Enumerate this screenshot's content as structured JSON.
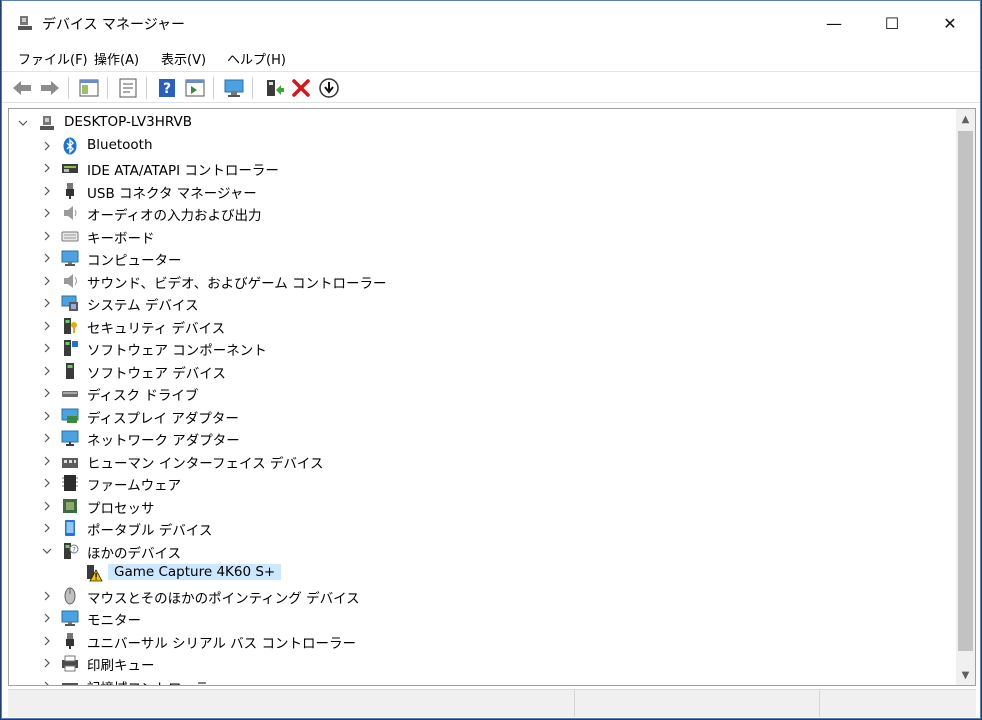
{
  "window": {
    "title": "デバイス マネージャー",
    "controls": {
      "minimize": "—",
      "maximize": "☐",
      "close": "✕"
    }
  },
  "menu": [
    {
      "label": "ファイル(F)"
    },
    {
      "label": "操作(A)"
    },
    {
      "label": "表示(V)"
    },
    {
      "label": "ヘルプ(H)"
    }
  ],
  "toolbar": [
    {
      "name": "back-icon",
      "enabled": false
    },
    {
      "name": "forward-icon",
      "enabled": false
    },
    {
      "name": "show-hide-console-tree-icon",
      "enabled": true
    },
    {
      "name": "properties-icon",
      "enabled": true
    },
    {
      "name": "help-icon",
      "enabled": true
    },
    {
      "name": "action-pane-icon",
      "enabled": true
    },
    {
      "name": "scan-hardware-icon",
      "enabled": true
    },
    {
      "name": "update-driver-icon",
      "enabled": true
    },
    {
      "name": "uninstall-device-icon",
      "enabled": true
    },
    {
      "name": "disable-device-icon",
      "enabled": true
    }
  ],
  "tree": {
    "root": {
      "label": "DESKTOP-LV3HRVB",
      "expanded": true,
      "icon": "computer-root-icon"
    },
    "items": [
      {
        "label": "Bluetooth",
        "icon": "bluetooth-icon",
        "level": 1,
        "expanded": false
      },
      {
        "label": "IDE ATA/ATAPI コントローラー",
        "icon": "ide-controller-icon",
        "level": 1,
        "expanded": false
      },
      {
        "label": "USB コネクタ マネージャー",
        "icon": "usb-connector-icon",
        "level": 1,
        "expanded": false
      },
      {
        "label": "オーディオの入力および出力",
        "icon": "speaker-icon",
        "level": 1,
        "expanded": false
      },
      {
        "label": "キーボード",
        "icon": "keyboard-icon",
        "level": 1,
        "expanded": false
      },
      {
        "label": "コンピューター",
        "icon": "monitor-icon",
        "level": 1,
        "expanded": false
      },
      {
        "label": "サウンド、ビデオ、およびゲーム コントローラー",
        "icon": "sound-icon",
        "level": 1,
        "expanded": false
      },
      {
        "label": "システム デバイス",
        "icon": "system-device-icon",
        "level": 1,
        "expanded": false
      },
      {
        "label": "セキュリティ デバイス",
        "icon": "security-device-icon",
        "level": 1,
        "expanded": false
      },
      {
        "label": "ソフトウェア コンポーネント",
        "icon": "software-component-icon",
        "level": 1,
        "expanded": false
      },
      {
        "label": "ソフトウェア デバイス",
        "icon": "software-device-icon",
        "level": 1,
        "expanded": false
      },
      {
        "label": "ディスク ドライブ",
        "icon": "disk-drive-icon",
        "level": 1,
        "expanded": false
      },
      {
        "label": "ディスプレイ アダプター",
        "icon": "display-adapter-icon",
        "level": 1,
        "expanded": false
      },
      {
        "label": "ネットワーク アダプター",
        "icon": "network-adapter-icon",
        "level": 1,
        "expanded": false
      },
      {
        "label": "ヒューマン インターフェイス デバイス",
        "icon": "hid-icon",
        "level": 1,
        "expanded": false
      },
      {
        "label": "ファームウェア",
        "icon": "firmware-icon",
        "level": 1,
        "expanded": false
      },
      {
        "label": "プロセッサ",
        "icon": "processor-icon",
        "level": 1,
        "expanded": false
      },
      {
        "label": "ポータブル デバイス",
        "icon": "portable-device-icon",
        "level": 1,
        "expanded": false
      },
      {
        "label": "ほかのデバイス",
        "icon": "unknown-device-icon",
        "level": 1,
        "expanded": true
      },
      {
        "label": "Game Capture 4K60 S+",
        "icon": "warning-device-icon",
        "level": 2,
        "selected": true
      },
      {
        "label": "マウスとそのほかのポインティング デバイス",
        "icon": "mouse-icon",
        "level": 1,
        "expanded": false
      },
      {
        "label": "モニター",
        "icon": "monitor-icon",
        "level": 1,
        "expanded": false
      },
      {
        "label": "ユニバーサル シリアル バス コントローラー",
        "icon": "usb-icon",
        "level": 1,
        "expanded": false
      },
      {
        "label": "印刷キュー",
        "icon": "printer-icon",
        "level": 1,
        "expanded": false
      },
      {
        "label": "記憶域コントローラー",
        "icon": "storage-controller-icon",
        "level": 1,
        "expanded": false
      }
    ]
  },
  "colors": {
    "selection": "#cce8ff",
    "desktop": "#1e3e6e",
    "scroll_thumb": "#c2c2c2"
  }
}
